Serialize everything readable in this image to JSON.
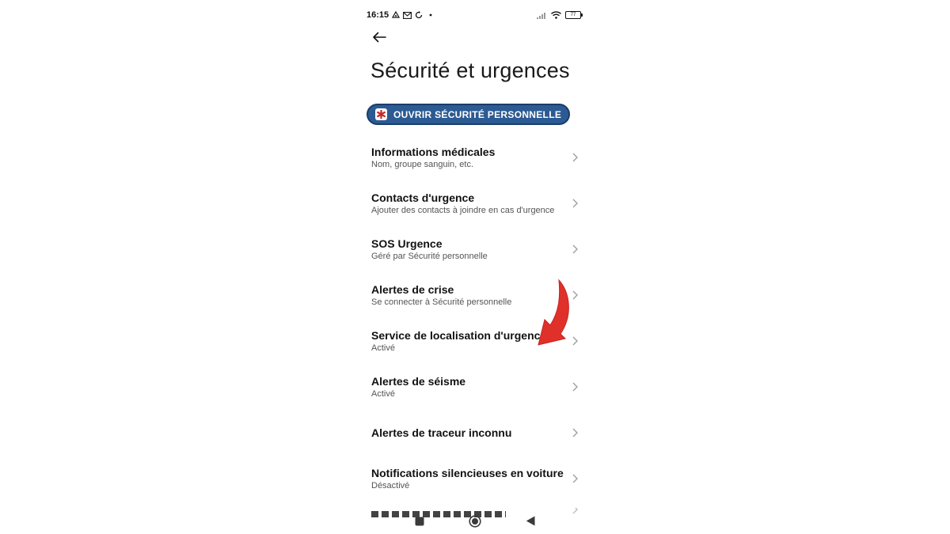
{
  "status_bar": {
    "time": "16:15",
    "battery": "77",
    "left_icons": [
      "vpn-icon",
      "mail-icon",
      "sync-icon",
      "dot-icon"
    ],
    "right_icons": [
      "signal-icon",
      "wifi-icon",
      "battery-icon"
    ]
  },
  "header": {
    "title": "Sécurité et urgences"
  },
  "open_button": {
    "label": "OUVRIR SÉCURITÉ PERSONNELLE",
    "background": "#2c5a93",
    "badge_color": "#c62828"
  },
  "items": [
    {
      "title": "Informations médicales",
      "subtitle": "Nom, groupe sanguin, etc."
    },
    {
      "title": "Contacts d'urgence",
      "subtitle": "Ajouter des contacts à joindre en cas d'urgence"
    },
    {
      "title": "SOS Urgence",
      "subtitle": "Géré par Sécurité personnelle"
    },
    {
      "title": "Alertes de crise",
      "subtitle": "Se connecter à Sécurité personnelle"
    },
    {
      "title": "Service de localisation d'urgence",
      "subtitle": "Activé"
    },
    {
      "title": "Alertes de séisme",
      "subtitle": "Activé"
    },
    {
      "title": "Alertes de traceur inconnu",
      "subtitle": ""
    },
    {
      "title": "Notifications silencieuses en voiture",
      "subtitle": "Désactivé"
    }
  ],
  "nav_bar": {
    "icons": [
      "recents-square-icon",
      "home-circle-icon",
      "back-triangle-icon"
    ]
  },
  "annotation": {
    "arrow_color": "#e0302a"
  }
}
